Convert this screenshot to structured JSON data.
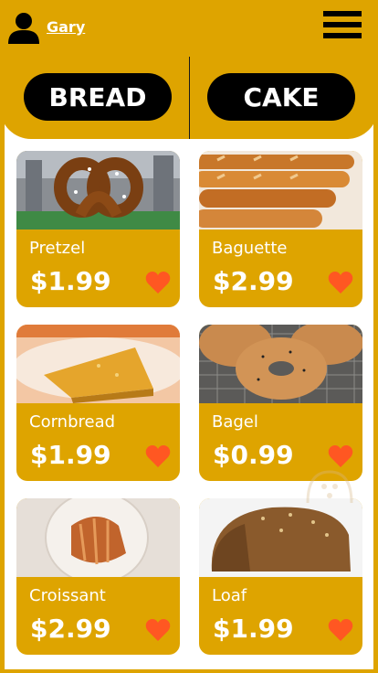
{
  "header": {
    "username": "Gary",
    "user_icon": "person-icon",
    "menu_icon": "hamburger-menu-icon"
  },
  "tabs": [
    {
      "label": "BREAD"
    },
    {
      "label": "CAKE"
    }
  ],
  "products": [
    {
      "name": "Pretzel",
      "price": "$1.99",
      "image": "pretzel-photo"
    },
    {
      "name": "Baguette",
      "price": "$2.99",
      "image": "baguette-photo"
    },
    {
      "name": "Cornbread",
      "price": "$1.99",
      "image": "cornbread-photo"
    },
    {
      "name": "Bagel",
      "price": "$0.99",
      "image": "bagel-photo"
    },
    {
      "name": "Croissant",
      "price": "$2.99",
      "image": "croissant-photo"
    },
    {
      "name": "Loaf",
      "price": "$1.99",
      "image": "loaf-photo"
    }
  ],
  "colors": {
    "accent": "#DEA400",
    "tab_bg": "#000000",
    "heart": "#FF5722",
    "text_light": "#FFFFFF"
  },
  "icons": {
    "favorite": "heart-icon"
  }
}
